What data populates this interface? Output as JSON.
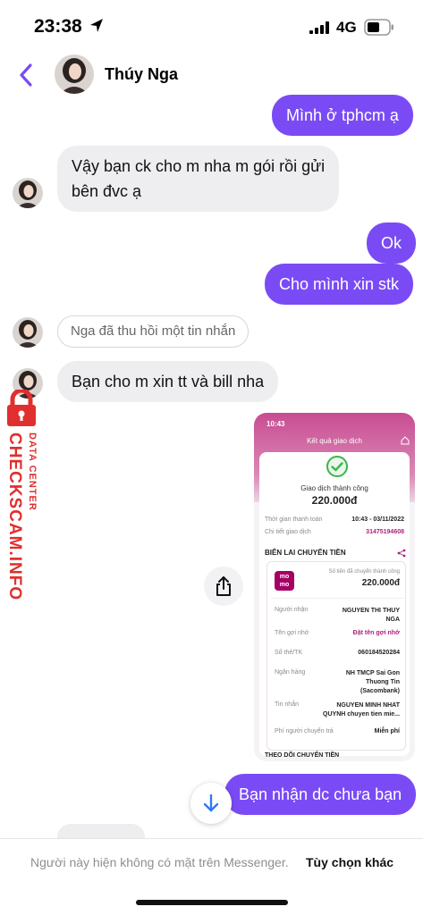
{
  "status_bar": {
    "time": "23:38",
    "network": "4G"
  },
  "header": {
    "contact_name": "Thúy Nga"
  },
  "messages": [
    {
      "dir": "out",
      "text": "Mình ở tphcm ạ"
    },
    {
      "dir": "in",
      "lines": [
        "Vậy bạn ck cho m nha m gói rồi gửi",
        "bên đvc ạ"
      ]
    },
    {
      "dir": "out",
      "text": "Ok"
    },
    {
      "dir": "out",
      "text": "Cho mình xin stk"
    },
    {
      "dir": "system",
      "text": "Nga đã thu hồi một tin nhắn"
    },
    {
      "dir": "in",
      "text": "Bạn cho m xin tt và bill nha"
    },
    {
      "dir": "out",
      "text": "Bạn nhận dc chưa bạn"
    }
  ],
  "receipt_screenshot": {
    "time": "10:43",
    "screen_title": "Kết quả giao dịch",
    "status": "Giao dịch thành công",
    "amount": "220.000đ",
    "time_label": "Thời gian thanh toán",
    "time_value": "10:43 - 03/11/2022",
    "detail_label": "Chi tiết giao dịch",
    "detail_value": "31475194608",
    "section_title": "BIÊN LAI CHUYỂN TIỀN",
    "logo_text": "mo mo",
    "transfer_amount_label": "Số tiền đã chuyển thành công",
    "transfer_amount": "220.000đ",
    "rows": [
      {
        "label": "Người nhận",
        "value": "NGUYEN THI THUY NGA"
      },
      {
        "label": "Tên gợi nhớ",
        "value": "Đặt tên gợi nhớ"
      },
      {
        "label": "Số thẻ/TK",
        "value": "060184520284"
      },
      {
        "label": "Ngân hàng",
        "value": "NH TMCP Sai Gon Thuong Tin (Sacombank)"
      },
      {
        "label": "Tin nhắn",
        "value": "NGUYEN MINH NHAT QUYNH chuyen tien mie..."
      },
      {
        "label": "Phí người chuyển trả",
        "value": "Miễn phí"
      }
    ],
    "follow_title": "THEO DÕI CHUYỂN TIỀN"
  },
  "watermark": {
    "main": "CHECKSCAM.INFO",
    "sub": "DATA CENTER"
  },
  "footer": {
    "message": "Người này hiện không có mặt trên Messenger.",
    "link": "Tùy chọn khác"
  },
  "colors": {
    "accent": "#7a4bf5",
    "incoming_bubble": "#eeeef0",
    "watermark": "#e02f2f",
    "momo": "#a50064"
  }
}
